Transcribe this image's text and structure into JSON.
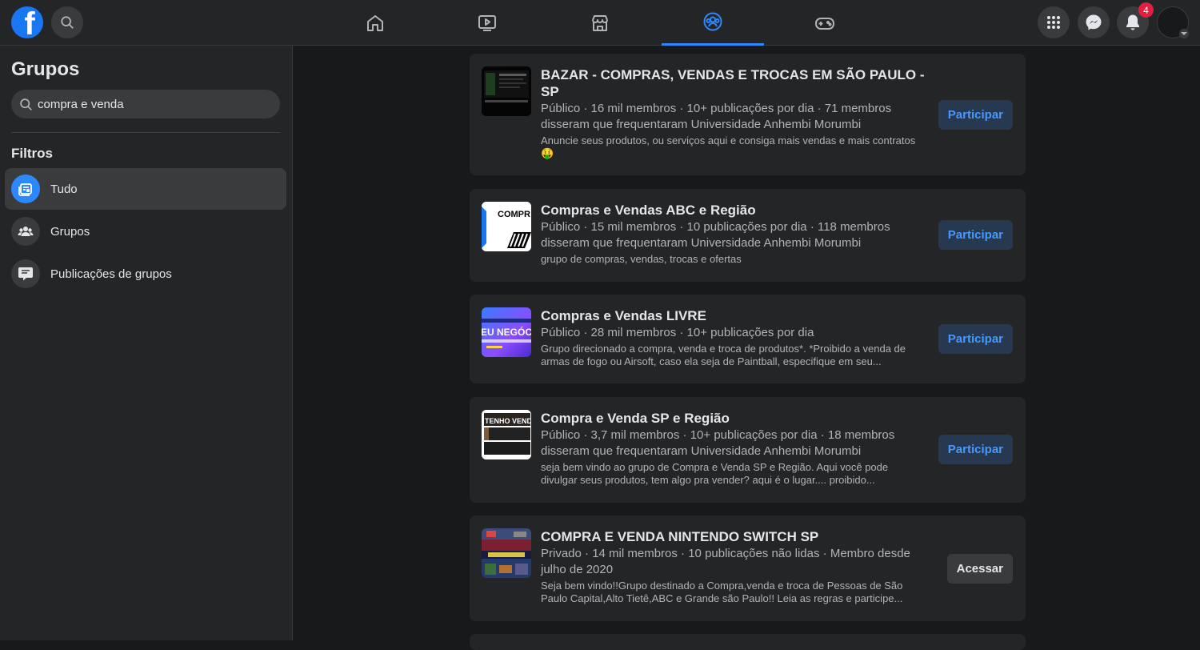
{
  "topbar": {
    "logo_letter": "f",
    "nav_tabs": [
      "home-icon",
      "watch-icon",
      "marketplace-icon",
      "groups-icon",
      "gaming-icon"
    ],
    "notification_count": "4"
  },
  "sidebar": {
    "title": "Grupos",
    "search_value": "compra e venda",
    "filters_title": "Filtros",
    "filters": [
      {
        "label": "Tudo",
        "icon": "all-results-icon"
      },
      {
        "label": "Grupos",
        "icon": "groups-icon"
      },
      {
        "label": "Publicações de grupos",
        "icon": "group-posts-icon"
      }
    ]
  },
  "results": [
    {
      "title": "BAZAR - COMPRAS, VENDAS E TROCAS EM SÃO PAULO - SP",
      "meta": "Público · 16 mil membros · 10+ publicações por dia · 71 membros disseram que frequentaram Universidade Anhembi Morumbi",
      "description": "Anuncie seus produtos, ou serviços aqui e consiga mais vendas e mais contratos 🤑",
      "button": "Participar"
    },
    {
      "title": "Compras e Vendas ABC e Região",
      "meta": "Público · 15 mil membros · 10 publicações por dia · 118 membros disseram que frequentaram Universidade Anhembi Morumbi",
      "description": "grupo de compras, vendas, trocas e ofertas",
      "button": "Participar",
      "thumb_text": "COMPR VENDAS"
    },
    {
      "title": "Compras e Vendas LIVRE",
      "meta": "Público · 28 mil membros · 10+ publicações por dia",
      "description": "Grupo direcionado a compra, venda e troca de produtos*. *Proibido a venda de armas de fogo ou Airsoft, caso ela seja de Paintball, especifique em seu...",
      "button": "Participar",
      "thumb_text": "EU NEGÓCIO"
    },
    {
      "title": "Compra e Venda SP e Região",
      "meta": "Público · 3,7 mil membros · 10+ publicações por dia · 18 membros disseram que frequentaram Universidade Anhembi Morumbi",
      "description": "seja bem vindo ao grupo de Compra e Venda SP e Região. Aqui você pode divulgar seus produtos, tem algo pra vender? aqui é o lugar.... proibido...",
      "button": "Participar",
      "thumb_text": "TENHO VENDE COMPRA"
    },
    {
      "title": "COMPRA E VENDA NINTENDO SWITCH SP",
      "meta": "Privado · 14 mil membros · 10 publicações não lidas · Membro desde julho de 2020",
      "description": "Seja bem vindo!!Grupo destinado a Compra,venda e troca de Pessoas de São Paulo Capital,Alto Tietê,ABC e Grande são Paulo!! Leia as regras e participe...",
      "button": "Acessar"
    }
  ]
}
